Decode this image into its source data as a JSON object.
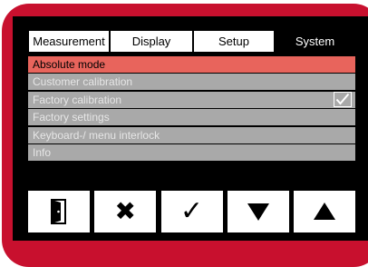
{
  "tabs": [
    {
      "label": "Measurement",
      "active": false
    },
    {
      "label": "Display",
      "active": false
    },
    {
      "label": "Setup",
      "active": false
    },
    {
      "label": "System",
      "active": true
    }
  ],
  "menu": {
    "items": [
      {
        "label": "Absolute mode",
        "selected": true
      },
      {
        "label": "Customer calibration"
      },
      {
        "label": "Factory calibration",
        "checked": true
      },
      {
        "label": "Factory settings"
      },
      {
        "label": "Keyboard-/ menu interlock"
      },
      {
        "label": "Info"
      }
    ]
  },
  "softkeys": [
    {
      "icon": "exit-door-icon"
    },
    {
      "icon": "cancel-x-icon",
      "glyph": "✖"
    },
    {
      "icon": "confirm-check-icon",
      "glyph": "✓"
    },
    {
      "icon": "arrow-down-icon"
    },
    {
      "icon": "arrow-up-icon"
    }
  ],
  "colors": {
    "bezel": "#c8102e",
    "selected_row": "#e8645c",
    "row": "#a9a9a9",
    "screen": "#000000"
  }
}
